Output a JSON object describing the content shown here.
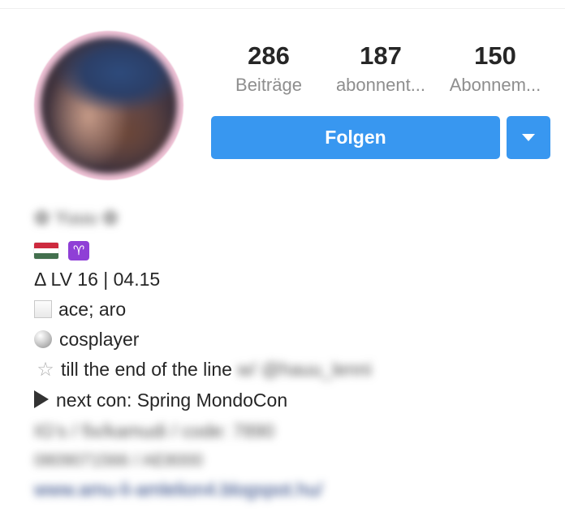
{
  "stats": {
    "posts": {
      "count": "286",
      "label": "Beiträge"
    },
    "followers": {
      "count": "187",
      "label": "abonnent..."
    },
    "following": {
      "count": "150",
      "label": "Abonnem..."
    }
  },
  "actions": {
    "follow_label": "Folgen",
    "dropdown_icon": "chevron-down-icon"
  },
  "bio": {
    "name_blurred": "✿ Yuuu ✿",
    "flag_colors": [
      "#cd2a3e",
      "#ffffff",
      "#436f4d"
    ],
    "zodiac_symbol": "♈",
    "line1": "Δ LV 16 | 04.15",
    "line2": "ace; aro",
    "line3": "cosplayer",
    "line4": "till the end of the line",
    "line4_blurred": "w/ @hauu_lenni",
    "star_symbol": "☆",
    "line5": "next con: Spring MondoCon",
    "blurred_line6": "IG's / fix/kamudi / code: 7890",
    "blurred_line7": "0809071566 / AE8000",
    "blurred_link": "www.amu-li-amlelion4.blogspot.hu/"
  },
  "colors": {
    "accent": "#3897f0",
    "text": "#262626",
    "muted": "#8e8e8e"
  }
}
